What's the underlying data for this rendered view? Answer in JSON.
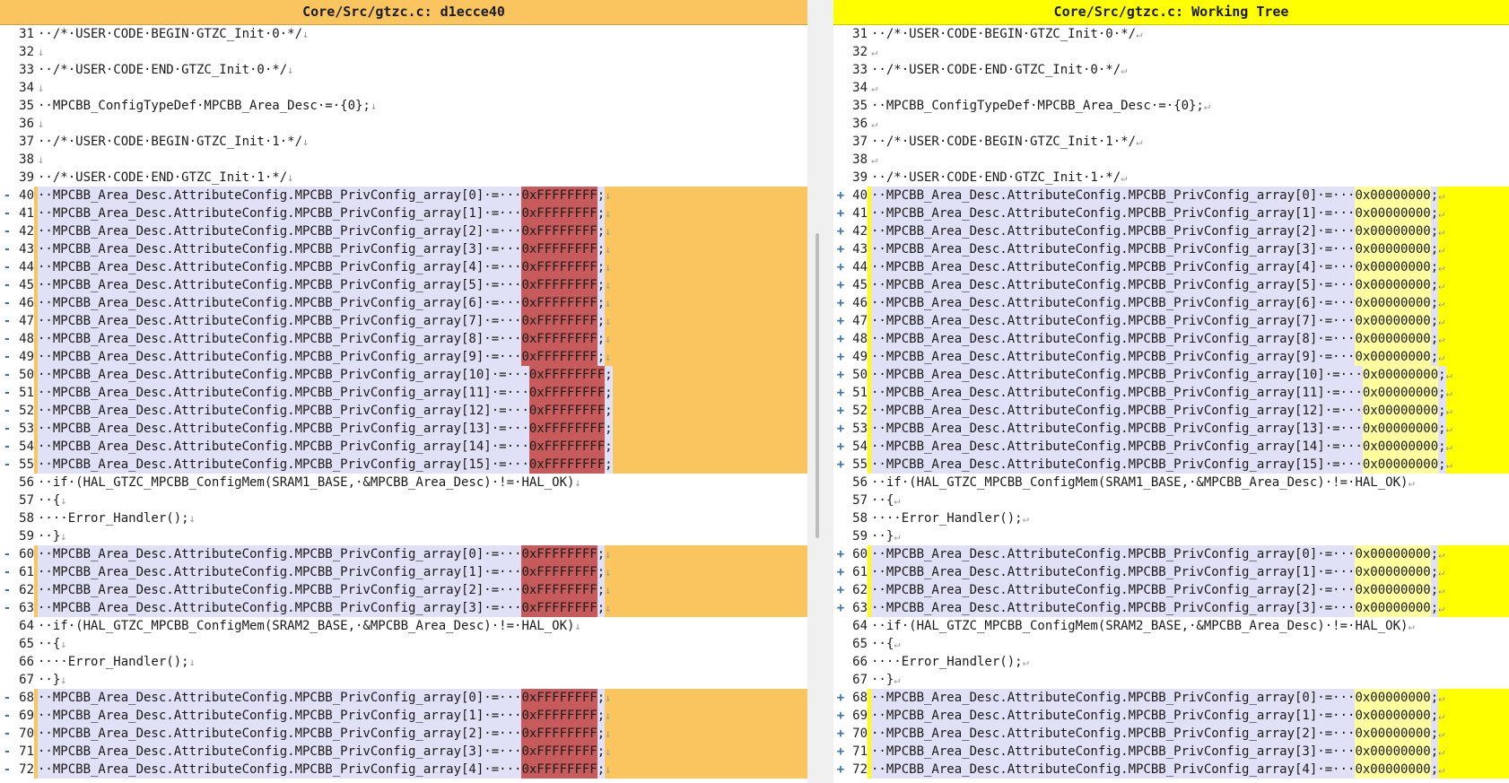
{
  "left": {
    "title": "Core/Src/gtzc.c: d1ecce40",
    "lines": [
      {
        "n": "31",
        "mk": "",
        "text": "··/*·USER·CODE·BEGIN·GTZC_Init·0·*/",
        "eol": "↓",
        "changed": false
      },
      {
        "n": "32",
        "mk": "",
        "text": "",
        "eol": "↓",
        "changed": false
      },
      {
        "n": "33",
        "mk": "",
        "text": "··/*·USER·CODE·END·GTZC_Init·0·*/",
        "eol": "↓",
        "changed": false
      },
      {
        "n": "34",
        "mk": "",
        "text": "",
        "eol": "↓",
        "changed": false
      },
      {
        "n": "35",
        "mk": "",
        "text": "··MPCBB_ConfigTypeDef·MPCBB_Area_Desc·=·{0};",
        "eol": "↓",
        "changed": false
      },
      {
        "n": "36",
        "mk": "",
        "text": "",
        "eol": "↓",
        "changed": false
      },
      {
        "n": "37",
        "mk": "",
        "text": "··/*·USER·CODE·BEGIN·GTZC_Init·1·*/",
        "eol": "↓",
        "changed": false
      },
      {
        "n": "38",
        "mk": "",
        "text": "",
        "eol": "↓",
        "changed": false
      },
      {
        "n": "39",
        "mk": "",
        "text": "··/*·USER·CODE·END·GTZC_Init·1·*/",
        "eol": "↓",
        "changed": false
      },
      {
        "n": "40",
        "mk": "-",
        "text": "··MPCBB_Area_Desc.AttributeConfig.MPCBB_PrivConfig_array[0]·=···",
        "val": "0xFFFFFFFF",
        "after": ";",
        "eol": "↓",
        "changed": true
      },
      {
        "n": "41",
        "mk": "-",
        "text": "··MPCBB_Area_Desc.AttributeConfig.MPCBB_PrivConfig_array[1]·=···",
        "val": "0xFFFFFFFF",
        "after": ";",
        "eol": "↓",
        "changed": true
      },
      {
        "n": "42",
        "mk": "-",
        "text": "··MPCBB_Area_Desc.AttributeConfig.MPCBB_PrivConfig_array[2]·=···",
        "val": "0xFFFFFFFF",
        "after": ";",
        "eol": "↓",
        "changed": true
      },
      {
        "n": "43",
        "mk": "-",
        "text": "··MPCBB_Area_Desc.AttributeConfig.MPCBB_PrivConfig_array[3]·=···",
        "val": "0xFFFFFFFF",
        "after": ";",
        "eol": "↓",
        "changed": true
      },
      {
        "n": "44",
        "mk": "-",
        "text": "··MPCBB_Area_Desc.AttributeConfig.MPCBB_PrivConfig_array[4]·=···",
        "val": "0xFFFFFFFF",
        "after": ";",
        "eol": "↓",
        "changed": true
      },
      {
        "n": "45",
        "mk": "-",
        "text": "··MPCBB_Area_Desc.AttributeConfig.MPCBB_PrivConfig_array[5]·=···",
        "val": "0xFFFFFFFF",
        "after": ";",
        "eol": "↓",
        "changed": true
      },
      {
        "n": "46",
        "mk": "-",
        "text": "··MPCBB_Area_Desc.AttributeConfig.MPCBB_PrivConfig_array[6]·=···",
        "val": "0xFFFFFFFF",
        "after": ";",
        "eol": "↓",
        "changed": true
      },
      {
        "n": "47",
        "mk": "-",
        "text": "··MPCBB_Area_Desc.AttributeConfig.MPCBB_PrivConfig_array[7]·=···",
        "val": "0xFFFFFFFF",
        "after": ";",
        "eol": "↓",
        "changed": true
      },
      {
        "n": "48",
        "mk": "-",
        "text": "··MPCBB_Area_Desc.AttributeConfig.MPCBB_PrivConfig_array[8]·=···",
        "val": "0xFFFFFFFF",
        "after": ";",
        "eol": "↓",
        "changed": true
      },
      {
        "n": "49",
        "mk": "-",
        "text": "··MPCBB_Area_Desc.AttributeConfig.MPCBB_PrivConfig_array[9]·=···",
        "val": "0xFFFFFFFF",
        "after": ";",
        "eol": "↓",
        "changed": true
      },
      {
        "n": "50",
        "mk": "-",
        "text": "··MPCBB_Area_Desc.AttributeConfig.MPCBB_PrivConfig_array[10]·=···",
        "val": "0xFFFFFFFF",
        "after": ";",
        "eol": "",
        "changed": true
      },
      {
        "n": "51",
        "mk": "-",
        "text": "··MPCBB_Area_Desc.AttributeConfig.MPCBB_PrivConfig_array[11]·=···",
        "val": "0xFFFFFFFF",
        "after": ";",
        "eol": "",
        "changed": true
      },
      {
        "n": "52",
        "mk": "-",
        "text": "··MPCBB_Area_Desc.AttributeConfig.MPCBB_PrivConfig_array[12]·=···",
        "val": "0xFFFFFFFF",
        "after": ";",
        "eol": "",
        "changed": true
      },
      {
        "n": "53",
        "mk": "-",
        "text": "··MPCBB_Area_Desc.AttributeConfig.MPCBB_PrivConfig_array[13]·=···",
        "val": "0xFFFFFFFF",
        "after": ";",
        "eol": "",
        "changed": true
      },
      {
        "n": "54",
        "mk": "-",
        "text": "··MPCBB_Area_Desc.AttributeConfig.MPCBB_PrivConfig_array[14]·=···",
        "val": "0xFFFFFFFF",
        "after": ";",
        "eol": "",
        "changed": true
      },
      {
        "n": "55",
        "mk": "-",
        "text": "··MPCBB_Area_Desc.AttributeConfig.MPCBB_PrivConfig_array[15]·=···",
        "val": "0xFFFFFFFF",
        "after": ";",
        "eol": "",
        "changed": true
      },
      {
        "n": "56",
        "mk": "",
        "text": "··if·(HAL_GTZC_MPCBB_ConfigMem(SRAM1_BASE,·&MPCBB_Area_Desc)·!=·HAL_OK)",
        "eol": "↓",
        "changed": false
      },
      {
        "n": "57",
        "mk": "",
        "text": "··{",
        "eol": "↓",
        "changed": false
      },
      {
        "n": "58",
        "mk": "",
        "text": "····Error_Handler();",
        "eol": "↓",
        "changed": false
      },
      {
        "n": "59",
        "mk": "",
        "text": "··}",
        "eol": "↓",
        "changed": false
      },
      {
        "n": "60",
        "mk": "-",
        "text": "··MPCBB_Area_Desc.AttributeConfig.MPCBB_PrivConfig_array[0]·=···",
        "val": "0xFFFFFFFF",
        "after": ";",
        "eol": "↓",
        "changed": true
      },
      {
        "n": "61",
        "mk": "-",
        "text": "··MPCBB_Area_Desc.AttributeConfig.MPCBB_PrivConfig_array[1]·=···",
        "val": "0xFFFFFFFF",
        "after": ";",
        "eol": "↓",
        "changed": true
      },
      {
        "n": "62",
        "mk": "-",
        "text": "··MPCBB_Area_Desc.AttributeConfig.MPCBB_PrivConfig_array[2]·=···",
        "val": "0xFFFFFFFF",
        "after": ";",
        "eol": "↓",
        "changed": true
      },
      {
        "n": "63",
        "mk": "-",
        "text": "··MPCBB_Area_Desc.AttributeConfig.MPCBB_PrivConfig_array[3]·=···",
        "val": "0xFFFFFFFF",
        "after": ";",
        "eol": "↓",
        "changed": true
      },
      {
        "n": "64",
        "mk": "",
        "text": "··if·(HAL_GTZC_MPCBB_ConfigMem(SRAM2_BASE,·&MPCBB_Area_Desc)·!=·HAL_OK)",
        "eol": "↓",
        "changed": false
      },
      {
        "n": "65",
        "mk": "",
        "text": "··{",
        "eol": "↓",
        "changed": false
      },
      {
        "n": "66",
        "mk": "",
        "text": "····Error_Handler();",
        "eol": "↓",
        "changed": false
      },
      {
        "n": "67",
        "mk": "",
        "text": "··}",
        "eol": "↓",
        "changed": false
      },
      {
        "n": "68",
        "mk": "-",
        "text": "··MPCBB_Area_Desc.AttributeConfig.MPCBB_PrivConfig_array[0]·=···",
        "val": "0xFFFFFFFF",
        "after": ";",
        "eol": "↓",
        "changed": true
      },
      {
        "n": "69",
        "mk": "-",
        "text": "··MPCBB_Area_Desc.AttributeConfig.MPCBB_PrivConfig_array[1]·=···",
        "val": "0xFFFFFFFF",
        "after": ";",
        "eol": "↓",
        "changed": true
      },
      {
        "n": "70",
        "mk": "-",
        "text": "··MPCBB_Area_Desc.AttributeConfig.MPCBB_PrivConfig_array[2]·=···",
        "val": "0xFFFFFFFF",
        "after": ";",
        "eol": "↓",
        "changed": true
      },
      {
        "n": "71",
        "mk": "-",
        "text": "··MPCBB_Area_Desc.AttributeConfig.MPCBB_PrivConfig_array[3]·=···",
        "val": "0xFFFFFFFF",
        "after": ";",
        "eol": "↓",
        "changed": true
      },
      {
        "n": "72",
        "mk": "-",
        "text": "··MPCBB_Area_Desc.AttributeConfig.MPCBB_PrivConfig_array[4]·=···",
        "val": "0xFFFFFFFF",
        "after": ";",
        "eol": "↓",
        "changed": true
      }
    ]
  },
  "right": {
    "title": "Core/Src/gtzc.c: Working Tree",
    "lines": [
      {
        "n": "31",
        "mk": "",
        "text": "··/*·USER·CODE·BEGIN·GTZC_Init·0·*/",
        "eol": "↵",
        "changed": false
      },
      {
        "n": "32",
        "mk": "",
        "text": "",
        "eol": "↵",
        "changed": false
      },
      {
        "n": "33",
        "mk": "",
        "text": "··/*·USER·CODE·END·GTZC_Init·0·*/",
        "eol": "↵",
        "changed": false
      },
      {
        "n": "34",
        "mk": "",
        "text": "",
        "eol": "↵",
        "changed": false
      },
      {
        "n": "35",
        "mk": "",
        "text": "··MPCBB_ConfigTypeDef·MPCBB_Area_Desc·=·{0};",
        "eol": "↵",
        "changed": false
      },
      {
        "n": "36",
        "mk": "",
        "text": "",
        "eol": "↵",
        "changed": false
      },
      {
        "n": "37",
        "mk": "",
        "text": "··/*·USER·CODE·BEGIN·GTZC_Init·1·*/",
        "eol": "↵",
        "changed": false
      },
      {
        "n": "38",
        "mk": "",
        "text": "",
        "eol": "↵",
        "changed": false
      },
      {
        "n": "39",
        "mk": "",
        "text": "··/*·USER·CODE·END·GTZC_Init·1·*/",
        "eol": "↵",
        "changed": false
      },
      {
        "n": "40",
        "mk": "+",
        "text": "··MPCBB_Area_Desc.AttributeConfig.MPCBB_PrivConfig_array[0]·=···",
        "val": "0x00000000",
        "after": ";",
        "eol": "↵",
        "changed": true
      },
      {
        "n": "41",
        "mk": "+",
        "text": "··MPCBB_Area_Desc.AttributeConfig.MPCBB_PrivConfig_array[1]·=···",
        "val": "0x00000000",
        "after": ";",
        "eol": "↵",
        "changed": true
      },
      {
        "n": "42",
        "mk": "+",
        "text": "··MPCBB_Area_Desc.AttributeConfig.MPCBB_PrivConfig_array[2]·=···",
        "val": "0x00000000",
        "after": ";",
        "eol": "↵",
        "changed": true
      },
      {
        "n": "43",
        "mk": "+",
        "text": "··MPCBB_Area_Desc.AttributeConfig.MPCBB_PrivConfig_array[3]·=···",
        "val": "0x00000000",
        "after": ";",
        "eol": "↵",
        "changed": true
      },
      {
        "n": "44",
        "mk": "+",
        "text": "··MPCBB_Area_Desc.AttributeConfig.MPCBB_PrivConfig_array[4]·=···",
        "val": "0x00000000",
        "after": ";",
        "eol": "↵",
        "changed": true
      },
      {
        "n": "45",
        "mk": "+",
        "text": "··MPCBB_Area_Desc.AttributeConfig.MPCBB_PrivConfig_array[5]·=···",
        "val": "0x00000000",
        "after": ";",
        "eol": "↵",
        "changed": true
      },
      {
        "n": "46",
        "mk": "+",
        "text": "··MPCBB_Area_Desc.AttributeConfig.MPCBB_PrivConfig_array[6]·=···",
        "val": "0x00000000",
        "after": ";",
        "eol": "↵",
        "changed": true
      },
      {
        "n": "47",
        "mk": "+",
        "text": "··MPCBB_Area_Desc.AttributeConfig.MPCBB_PrivConfig_array[7]·=···",
        "val": "0x00000000",
        "after": ";",
        "eol": "↵",
        "changed": true
      },
      {
        "n": "48",
        "mk": "+",
        "text": "··MPCBB_Area_Desc.AttributeConfig.MPCBB_PrivConfig_array[8]·=···",
        "val": "0x00000000",
        "after": ";",
        "eol": "↵",
        "changed": true
      },
      {
        "n": "49",
        "mk": "+",
        "text": "··MPCBB_Area_Desc.AttributeConfig.MPCBB_PrivConfig_array[9]·=···",
        "val": "0x00000000",
        "after": ";",
        "eol": "↵",
        "changed": true
      },
      {
        "n": "50",
        "mk": "+",
        "text": "··MPCBB_Area_Desc.AttributeConfig.MPCBB_PrivConfig_array[10]·=···",
        "val": "0x00000000",
        "after": ";",
        "eol": "↵",
        "changed": true
      },
      {
        "n": "51",
        "mk": "+",
        "text": "··MPCBB_Area_Desc.AttributeConfig.MPCBB_PrivConfig_array[11]·=···",
        "val": "0x00000000",
        "after": ";",
        "eol": "↵",
        "changed": true
      },
      {
        "n": "52",
        "mk": "+",
        "text": "··MPCBB_Area_Desc.AttributeConfig.MPCBB_PrivConfig_array[12]·=···",
        "val": "0x00000000",
        "after": ";",
        "eol": "↵",
        "changed": true
      },
      {
        "n": "53",
        "mk": "+",
        "text": "··MPCBB_Area_Desc.AttributeConfig.MPCBB_PrivConfig_array[13]·=···",
        "val": "0x00000000",
        "after": ";",
        "eol": "↵",
        "changed": true
      },
      {
        "n": "54",
        "mk": "+",
        "text": "··MPCBB_Area_Desc.AttributeConfig.MPCBB_PrivConfig_array[14]·=···",
        "val": "0x00000000",
        "after": ";",
        "eol": "↵",
        "changed": true
      },
      {
        "n": "55",
        "mk": "+",
        "text": "··MPCBB_Area_Desc.AttributeConfig.MPCBB_PrivConfig_array[15]·=···",
        "val": "0x00000000",
        "after": ";",
        "eol": "↵",
        "changed": true
      },
      {
        "n": "56",
        "mk": "",
        "text": "··if·(HAL_GTZC_MPCBB_ConfigMem(SRAM1_BASE,·&MPCBB_Area_Desc)·!=·HAL_OK)",
        "eol": "↵",
        "changed": false
      },
      {
        "n": "57",
        "mk": "",
        "text": "··{",
        "eol": "↵",
        "changed": false
      },
      {
        "n": "58",
        "mk": "",
        "text": "····Error_Handler();",
        "eol": "↵",
        "changed": false
      },
      {
        "n": "59",
        "mk": "",
        "text": "··}",
        "eol": "↵",
        "changed": false
      },
      {
        "n": "60",
        "mk": "+",
        "text": "··MPCBB_Area_Desc.AttributeConfig.MPCBB_PrivConfig_array[0]·=···",
        "val": "0x00000000",
        "after": ";",
        "eol": "↵",
        "changed": true
      },
      {
        "n": "61",
        "mk": "+",
        "text": "··MPCBB_Area_Desc.AttributeConfig.MPCBB_PrivConfig_array[1]·=···",
        "val": "0x00000000",
        "after": ";",
        "eol": "↵",
        "changed": true
      },
      {
        "n": "62",
        "mk": "+",
        "text": "··MPCBB_Area_Desc.AttributeConfig.MPCBB_PrivConfig_array[2]·=···",
        "val": "0x00000000",
        "after": ";",
        "eol": "↵",
        "changed": true
      },
      {
        "n": "63",
        "mk": "+",
        "text": "··MPCBB_Area_Desc.AttributeConfig.MPCBB_PrivConfig_array[3]·=···",
        "val": "0x00000000",
        "after": ";",
        "eol": "↵",
        "changed": true
      },
      {
        "n": "64",
        "mk": "",
        "text": "··if·(HAL_GTZC_MPCBB_ConfigMem(SRAM2_BASE,·&MPCBB_Area_Desc)·!=·HAL_OK)",
        "eol": "↵",
        "changed": false
      },
      {
        "n": "65",
        "mk": "",
        "text": "··{",
        "eol": "↵",
        "changed": false
      },
      {
        "n": "66",
        "mk": "",
        "text": "····Error_Handler();",
        "eol": "↵",
        "changed": false
      },
      {
        "n": "67",
        "mk": "",
        "text": "··}",
        "eol": "↵",
        "changed": false
      },
      {
        "n": "68",
        "mk": "+",
        "text": "··MPCBB_Area_Desc.AttributeConfig.MPCBB_PrivConfig_array[0]·=···",
        "val": "0x00000000",
        "after": ";",
        "eol": "↵",
        "changed": true
      },
      {
        "n": "69",
        "mk": "+",
        "text": "··MPCBB_Area_Desc.AttributeConfig.MPCBB_PrivConfig_array[1]·=···",
        "val": "0x00000000",
        "after": ";",
        "eol": "↵",
        "changed": true
      },
      {
        "n": "70",
        "mk": "+",
        "text": "··MPCBB_Area_Desc.AttributeConfig.MPCBB_PrivConfig_array[2]·=···",
        "val": "0x00000000",
        "after": ";",
        "eol": "↵",
        "changed": true
      },
      {
        "n": "71",
        "mk": "+",
        "text": "··MPCBB_Area_Desc.AttributeConfig.MPCBB_PrivConfig_array[3]·=···",
        "val": "0x00000000",
        "after": ";",
        "eol": "↵",
        "changed": true
      },
      {
        "n": "72",
        "mk": "+",
        "text": "··MPCBB_Area_Desc.AttributeConfig.MPCBB_PrivConfig_array[4]·=···",
        "val": "0x00000000",
        "after": ";",
        "eol": "↵",
        "changed": true
      }
    ]
  },
  "colors": {
    "left_header": "#fac55e",
    "right_header": "#ffff00",
    "changed_line_bg": "#e0e0f6",
    "removed_value_bg": "#c75b5b",
    "added_value_bg": "#ffffa0"
  }
}
